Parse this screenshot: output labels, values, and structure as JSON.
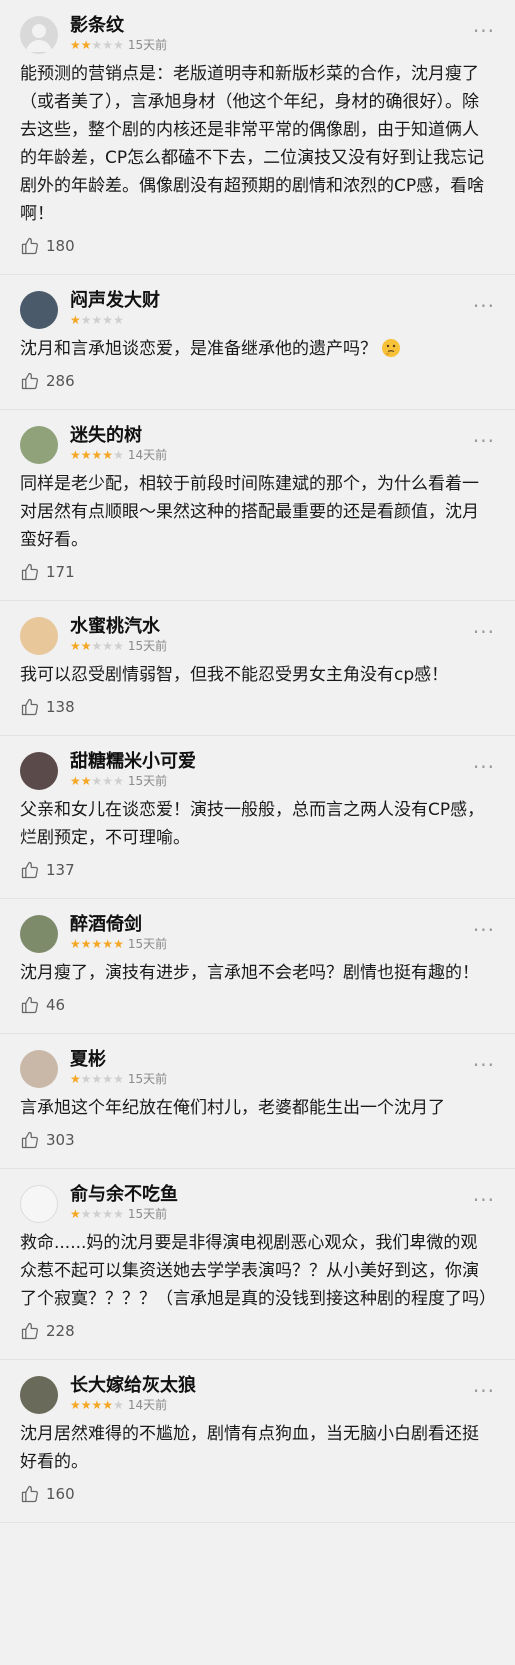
{
  "comments": [
    {
      "name": "影条纹",
      "rating": 2,
      "time": "15天前",
      "text": "能预测的营销点是：老版道明寺和新版杉菜的合作，沈月瘦了（或者美了），言承旭身材（他这个年纪，身材的确很好）。除去这些，整个剧的内核还是非常平常的偶像剧，由于知道俩人的年龄差，CP怎么都磕不下去，二位演技又没有好到让我忘记剧外的年龄差。偶像剧没有超预期的剧情和浓烈的CP感，看啥啊！",
      "likes": "180",
      "avatar_color": "#d9d9d9"
    },
    {
      "name": "闷声发大财",
      "rating": 1,
      "time": "",
      "text": "沈月和言承旭谈恋爱，是准备继承他的遗产吗？",
      "emoji": "thinking-face",
      "likes": "286",
      "avatar_color": "#4a5a6a"
    },
    {
      "name": "迷失的树",
      "rating": 4,
      "time": "14天前",
      "text": "同样是老少配，相较于前段时间陈建斌的那个，为什么看着一对居然有点顺眼～果然这种的搭配最重要的还是看颜值，沈月蛮好看。",
      "likes": "171",
      "avatar_color": "#8fa27a"
    },
    {
      "name": "水蜜桃汽水",
      "rating": 2,
      "time": "15天前",
      "text": "我可以忍受剧情弱智，但我不能忍受男女主角没有cp感！",
      "likes": "138",
      "avatar_color": "#e8c79a"
    },
    {
      "name": "甜糖糯米小可爱",
      "rating": 2,
      "time": "15天前",
      "text": "父亲和女儿在谈恋爱！演技一般般，总而言之两人没有CP感，烂剧预定，不可理喻。",
      "likes": "137",
      "avatar_color": "#5a4a4a"
    },
    {
      "name": "醉酒倚剑",
      "rating": 5,
      "time": "15天前",
      "text": "沈月瘦了，演技有进步，言承旭不会老吗？剧情也挺有趣的！",
      "likes": "46",
      "avatar_color": "#7d8b6a"
    },
    {
      "name": "夏彬",
      "rating": 1,
      "time": "15天前",
      "text": "言承旭这个年纪放在俺们村儿，老婆都能生出一个沈月了",
      "likes": "303",
      "avatar_color": "#c9b8a8"
    },
    {
      "name": "俞与余不吃鱼",
      "rating": 1,
      "time": "15天前",
      "text": "救命......妈的沈月要是非得演电视剧恶心观众，我们卑微的观众惹不起可以集资送她去学学表演吗？？从小美好到这，你演了个寂寞？？？？（言承旭是真的没钱到接这种剧的程度了吗）",
      "likes": "228",
      "avatar_color": "#f6f6f6"
    },
    {
      "name": "长大嫁给灰太狼",
      "rating": 4,
      "time": "14天前",
      "text": "沈月居然难得的不尴尬，剧情有点狗血，当无脑小白剧看还挺好看的。",
      "likes": "160",
      "avatar_color": "#6a6a5a"
    }
  ]
}
